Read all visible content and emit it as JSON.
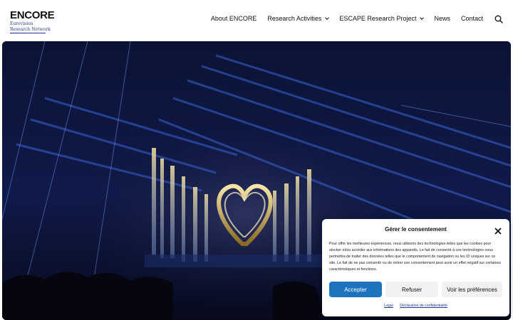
{
  "logo": {
    "title": "ENCORE",
    "line1": "Eurovision",
    "line2": "Research Network"
  },
  "nav": {
    "items": [
      {
        "label": "About ENCORE",
        "has_dropdown": false
      },
      {
        "label": "Research Activities",
        "has_dropdown": true
      },
      {
        "label": "ESCAPE Research Project",
        "has_dropdown": true
      },
      {
        "label": "News",
        "has_dropdown": false
      },
      {
        "label": "Contact",
        "has_dropdown": false
      }
    ],
    "search_icon": "search-icon"
  },
  "hero": {
    "image": "eurovision-stage-with-golden-heart"
  },
  "consent": {
    "title": "Gérer le consentement",
    "text": "Pour offrir les meilleures expériences, nous utilisons des technologies telles que les cookies pour stocker et/ou accéder aux informations des appareils. Le fait de consentir à ces technologies nous permettra de traiter des données telles que le comportement de navigation ou les ID uniques sur ce site. Le fait de ne pas consentir ou de retirer son consentement peut avoir un effet négatif sur certaines caractéristiques et fonctions.",
    "accept": "Accepter",
    "refuse": "Refuser",
    "preferences": "Voir les préférences",
    "links": [
      "Legal",
      "Déclaration de confidentialité"
    ],
    "colors": {
      "accept_bg": "#1e73be",
      "secondary_bg": "#f2f2f2"
    }
  }
}
